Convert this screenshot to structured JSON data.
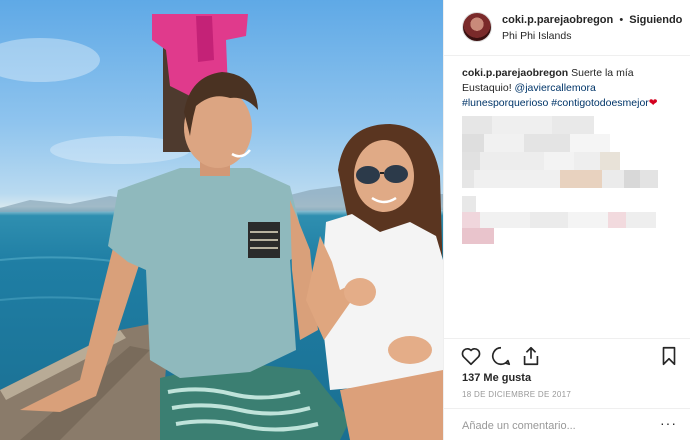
{
  "post": {
    "username": "coki.p.parejaobregon",
    "separator": "•",
    "follow_status": "Siguiendo",
    "location": "Phi Phi Islands"
  },
  "caption": {
    "username": "coki.p.parejaobregon",
    "text": "Suerte la mía Eustaquio!",
    "mention": "@javiercallemora",
    "hashtags": "#lunesporquerioso #contigotodoesmejor",
    "emoji": "❤"
  },
  "actions": {
    "like_icon": "heart-outline-icon",
    "comment_icon": "comment-bubble-icon",
    "share_icon": "share-arrow-icon",
    "save_icon": "bookmark-icon"
  },
  "likes_text": "137 Me gusta",
  "date_text": "18 DE DICIEMBRE DE 2017",
  "comment": {
    "placeholder": "Añade un comentario...",
    "more_label": "···"
  },
  "colors": {
    "link": "#003569",
    "heart": "#d4001f",
    "muted": "#999999",
    "text": "#262626"
  }
}
